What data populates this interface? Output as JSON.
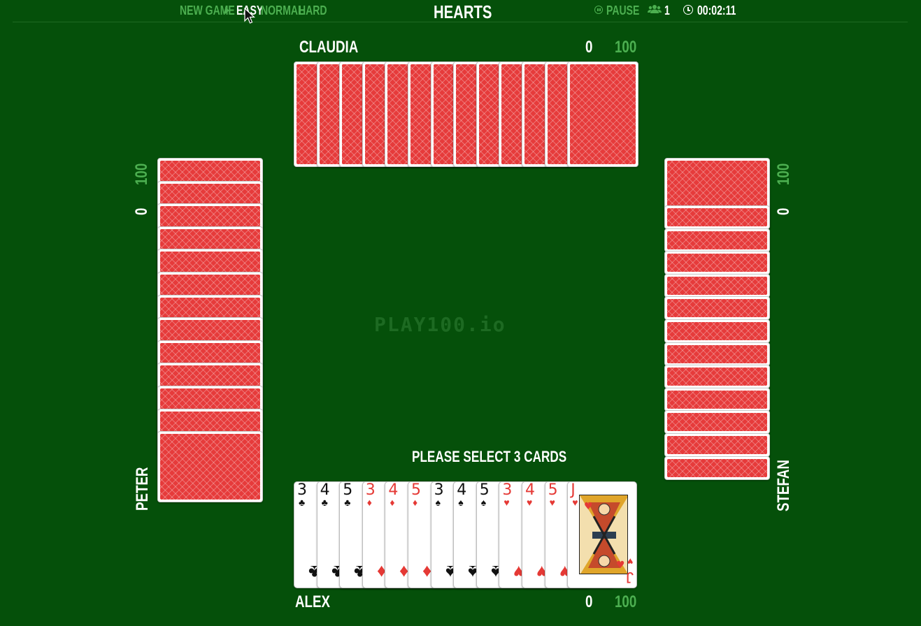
{
  "topbar": {
    "new_game": "NEW GAME",
    "difficulties": [
      "EASY",
      "NORMAL",
      "HARD"
    ],
    "selected_difficulty": "EASY",
    "title": "HEARTS",
    "pause": "PAUSE",
    "players_count": "1",
    "timer": "00:02:11"
  },
  "watermark": "PLAY100.io",
  "prompt": "PLEASE SELECT 3 CARDS",
  "players": {
    "north": {
      "name": "CLAUDIA",
      "score": "0",
      "target": "100",
      "cards": 13
    },
    "west": {
      "name": "PETER",
      "score": "0",
      "target": "100",
      "cards": 13
    },
    "east": {
      "name": "STEFAN",
      "score": "0",
      "target": "100",
      "cards": 13
    },
    "south": {
      "name": "ALEX",
      "score": "0",
      "target": "100",
      "cards": 13
    }
  },
  "hand": [
    {
      "rank": "3",
      "suit": "♣",
      "color": "black"
    },
    {
      "rank": "4",
      "suit": "♣",
      "color": "black"
    },
    {
      "rank": "5",
      "suit": "♣",
      "color": "black"
    },
    {
      "rank": "3",
      "suit": "♦",
      "color": "red"
    },
    {
      "rank": "4",
      "suit": "♦",
      "color": "red"
    },
    {
      "rank": "5",
      "suit": "♦",
      "color": "red"
    },
    {
      "rank": "3",
      "suit": "♠",
      "color": "black"
    },
    {
      "rank": "4",
      "suit": "♠",
      "color": "black"
    },
    {
      "rank": "5",
      "suit": "♠",
      "color": "black"
    },
    {
      "rank": "3",
      "suit": "♥",
      "color": "red"
    },
    {
      "rank": "4",
      "suit": "♥",
      "color": "red"
    },
    {
      "rank": "5",
      "suit": "♥",
      "color": "red"
    },
    {
      "rank": "J",
      "suit": "♥",
      "color": "red"
    }
  ],
  "colors": {
    "table": "#05500a",
    "accent": "#4caf50",
    "card_back": "#e63b3b",
    "suit_red": "#e53935"
  },
  "icons": {
    "difficulty_arrow": "caret-right-icon",
    "pause": "pause-circle-icon",
    "players": "users-icon",
    "timer": "clock-icon",
    "cursor": "mouse-pointer-icon"
  }
}
